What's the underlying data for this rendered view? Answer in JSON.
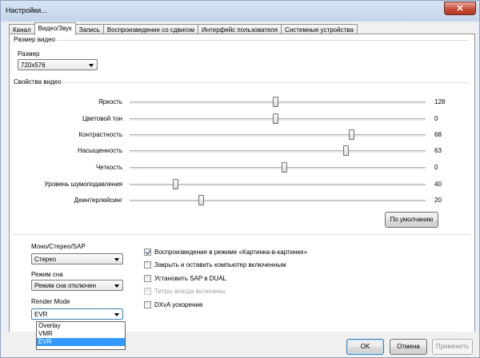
{
  "window": {
    "title": "Настройки...",
    "close_glyph": "✕"
  },
  "tabs": [
    {
      "label": "Канал"
    },
    {
      "label": "Видео/Звук"
    },
    {
      "label": "Запись"
    },
    {
      "label": "Воспроизведение со сдвигом"
    },
    {
      "label": "Интерфейс пользователя"
    },
    {
      "label": "Системные устройства"
    }
  ],
  "video_size": {
    "group_title": "Размер видео",
    "size_label": "Размер",
    "size_value": "720x576"
  },
  "video_props": {
    "group_title": "Свойства видео",
    "sliders": [
      {
        "label": "Яркость",
        "value": "128"
      },
      {
        "label": "Цветовой тон",
        "value": "0"
      },
      {
        "label": "Контрастность",
        "value": "68"
      },
      {
        "label": "Насыщенность",
        "value": "63"
      },
      {
        "label": "Четкость",
        "value": "0"
      },
      {
        "label": "Уровень шумоподавления",
        "value": "40"
      },
      {
        "label": "Деинтерлейсинг",
        "value": "20"
      }
    ],
    "default_button": "По умолчанию"
  },
  "audio": {
    "mode_label": "Моно/Стерео/SAP",
    "mode_value": "Стерео",
    "sleep_label": "Режим сна",
    "sleep_value": "Режим сна отключен",
    "render_label": "Render Mode",
    "render_value": "EVR",
    "render_options": [
      "Overlay",
      "VMR",
      "EVR"
    ]
  },
  "options": [
    {
      "label": "Воспроизведение в режиме «Картинка-в-картинке»",
      "checked": true,
      "enabled": true
    },
    {
      "label": "Закрыть и оставить компьютер включенным",
      "checked": false,
      "enabled": true
    },
    {
      "label": "Установить SAP в DUAL",
      "checked": false,
      "enabled": true
    },
    {
      "label": "Титры всегда включены",
      "checked": false,
      "enabled": false
    },
    {
      "label": "DXvA ускорение",
      "checked": false,
      "enabled": true
    }
  ],
  "footer": {
    "ok": "OK",
    "cancel": "Отмена",
    "apply": "Применить"
  }
}
